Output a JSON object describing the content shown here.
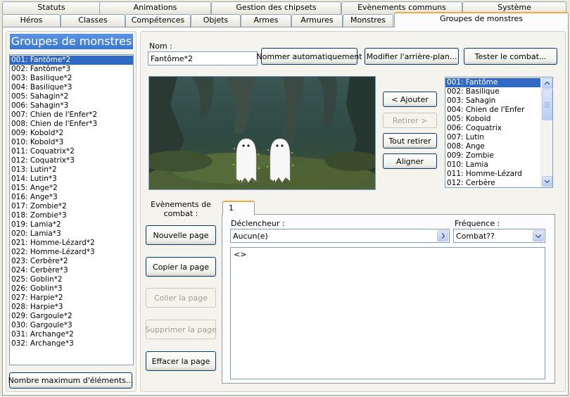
{
  "tabs_row1": [
    "Statuts",
    "Animations",
    "Gestion des chipsets",
    "Evènements communs",
    "Système"
  ],
  "tabs_row2": [
    "Héros",
    "Classes",
    "Compétences",
    "Objets",
    "Armes",
    "Armures",
    "Monstres",
    "Groupes de monstres"
  ],
  "left": {
    "title": "Groupes de monstres",
    "items": [
      "001: Fantôme*2",
      "002: Fantôme*3",
      "003: Basilique*2",
      "004: Basilique*3",
      "005: Sahagin*2",
      "006: Sahagin*3",
      "007: Chien de l'Enfer*2",
      "008: Chien de l'Enfer*3",
      "009: Kobold*2",
      "010: Kobold*3",
      "011: Coquatrix*2",
      "012: Coquatrix*3",
      "013: Lutin*2",
      "014: Lutin*3",
      "015: Ange*2",
      "016: Ange*3",
      "017: Zombie*2",
      "018: Zombie*3",
      "019: Lamia*2",
      "020: Lamia*3",
      "021: Homme-Lézard*2",
      "022: Homme-Lézard*3",
      "023: Cerbère*2",
      "024: Cerbère*3",
      "025: Goblin*2",
      "026: Goblin*3",
      "027: Harpie*2",
      "028: Harpie*3",
      "029: Gargoule*2",
      "030: Gargoule*3",
      "031: Archange*2",
      "032: Archange*3"
    ],
    "max_button": "Nombre maximum d'éléments..."
  },
  "name_label": "Nom :",
  "name_value": "Fantôme*2",
  "auto_name_button": "Nommer automatiquement",
  "background_button": "Modifier l'arrière-plan...",
  "test_button": "Tester le combat...",
  "add_button": "< Ajouter",
  "remove_button": "Retirer >",
  "remove_all_button": "Tout retirer",
  "align_button": "Aligner",
  "monsters": [
    "001: Fantôme",
    "002: Basilique",
    "003: Sahagin",
    "004: Chien de l'Enfer",
    "005: Kobold",
    "006: Coquatrix",
    "007: Lutin",
    "008: Ange",
    "009: Zombie",
    "010: Lamia",
    "011: Homme-Lézard",
    "012: Cerbère"
  ],
  "events_label": "Evènements de combat :",
  "new_page_button": "Nouvelle page",
  "copy_page_button": "Copier la page",
  "paste_page_button": "Coller la page",
  "delete_page_button": "Supprimer la page",
  "clear_page_button": "Effacer la page",
  "page_tab": "1",
  "trigger_label": "Déclencheur :",
  "trigger_value": "Aucun(e)",
  "frequency_label": "Fréquence :",
  "frequency_value": "Combat??",
  "event_command": "<>",
  "colors": {
    "accent": "#316ac5",
    "title_bg": "#3c7fd8",
    "tab_active_border": "#f5a941"
  }
}
